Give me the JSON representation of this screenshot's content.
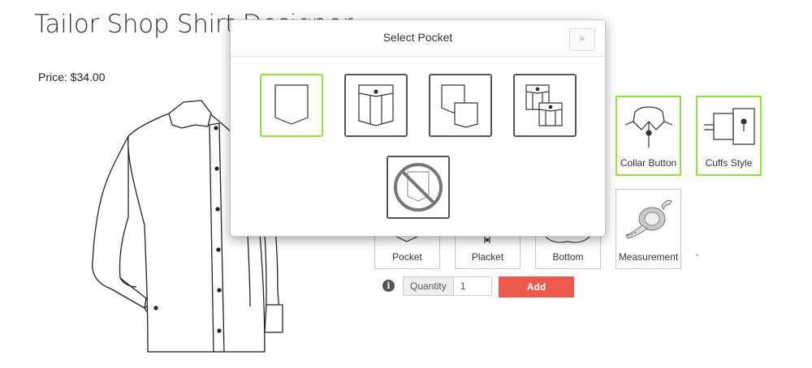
{
  "page": {
    "title": "Tailor Shop Shirt Designer",
    "price": "Price: $34.00"
  },
  "options": {
    "collar_button": {
      "label": "Collar Button",
      "icon": "collar-button-icon"
    },
    "cuffs_style": {
      "label": "Cuffs Style",
      "icon": "cuff-icon"
    },
    "pocket": {
      "label": "Pocket",
      "icon": "pocket-icon"
    },
    "placket": {
      "label": "Placket",
      "icon": "placket-icon"
    },
    "bottom": {
      "label": "Bottom",
      "icon": "shirt-bottom-icon"
    },
    "measurement": {
      "label": "Measurement",
      "icon": "measuring-tape-icon"
    }
  },
  "cart": {
    "quantity_label": "Quantity",
    "quantity_value": "1",
    "add_label": "Add",
    "info_icon": "i"
  },
  "modal": {
    "title": "Select Pocket",
    "close": "×",
    "options": [
      {
        "name": "plain-pocket",
        "selected": true
      },
      {
        "name": "flap-pocket",
        "selected": false
      },
      {
        "name": "double-pocket",
        "selected": false
      },
      {
        "name": "double-flap-pocket",
        "selected": false
      },
      {
        "name": "no-pocket",
        "selected": false
      }
    ]
  },
  "colors": {
    "selected_border": "#94e33a",
    "add_button": "#ef5a4f"
  }
}
